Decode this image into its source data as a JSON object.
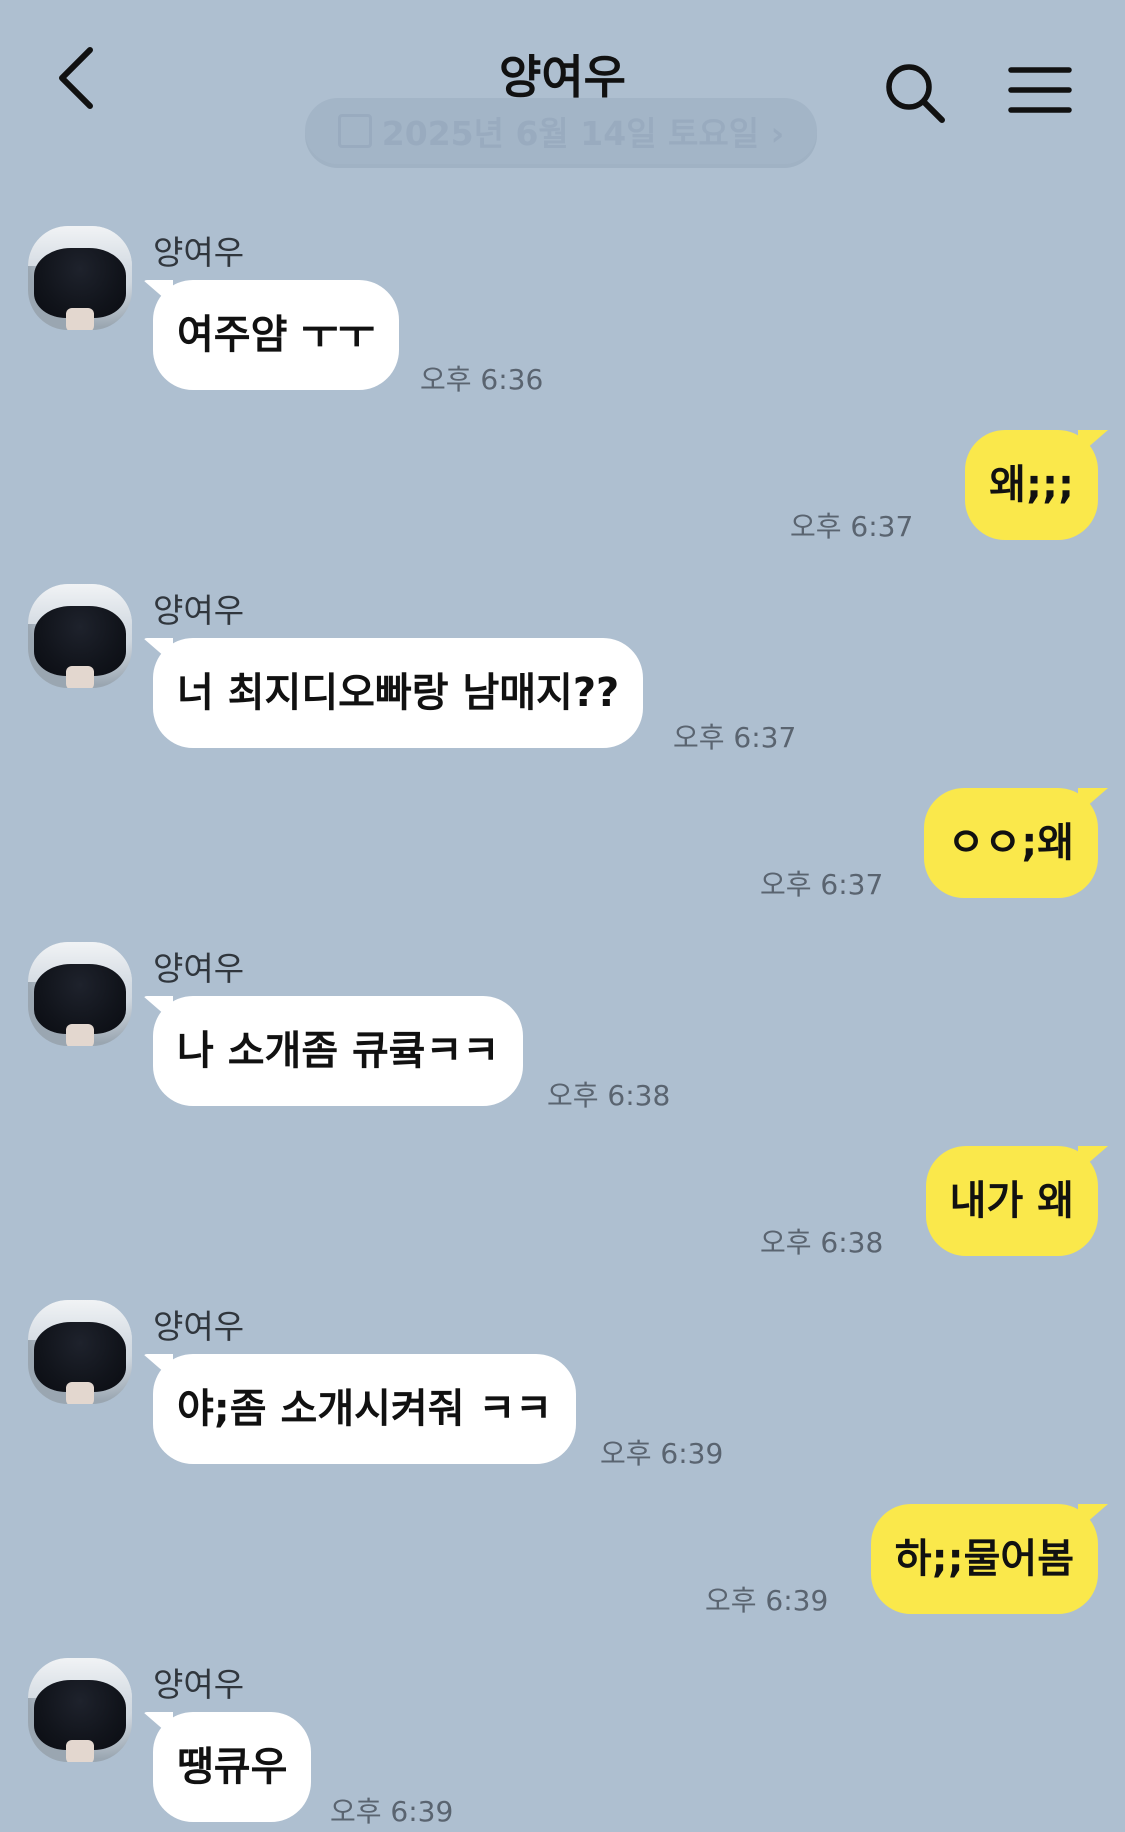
{
  "header": {
    "back_icon": "chevron-left-icon",
    "title": "양여우",
    "search_icon": "search-icon",
    "menu_icon": "hamburger-menu-icon"
  },
  "date_banner": {
    "text": "2025년 6월 14일 토요일 ›"
  },
  "colors": {
    "background": "#aebfd0",
    "incoming_bubble": "#ffffff",
    "outgoing_bubble": "#fae84b"
  },
  "messages": [
    {
      "direction": "in",
      "sender": "양여우",
      "text": "여주얌 ㅜㅜ",
      "time": "오후 6:36"
    },
    {
      "direction": "out",
      "text": "왜;;;",
      "time": "오후 6:37"
    },
    {
      "direction": "in",
      "sender": "양여우",
      "text": "너 최지디오빠랑 남매지??",
      "time": "오후 6:37"
    },
    {
      "direction": "out",
      "text": "ㅇㅇ;왜",
      "time": "오후 6:37"
    },
    {
      "direction": "in",
      "sender": "양여우",
      "text": "나 소개좀 큐큨ㅋㅋ",
      "time": "오후 6:38"
    },
    {
      "direction": "out",
      "text": "내가 왜",
      "time": "오후 6:38"
    },
    {
      "direction": "in",
      "sender": "양여우",
      "text": "야;좀 소개시켜줘 ㅋㅋ",
      "time": "오후 6:39"
    },
    {
      "direction": "out",
      "text": "하;;물어봄",
      "time": "오후 6:39"
    },
    {
      "direction": "in",
      "sender": "양여우",
      "text": "땡큐우",
      "time": "오후 6:39"
    }
  ]
}
